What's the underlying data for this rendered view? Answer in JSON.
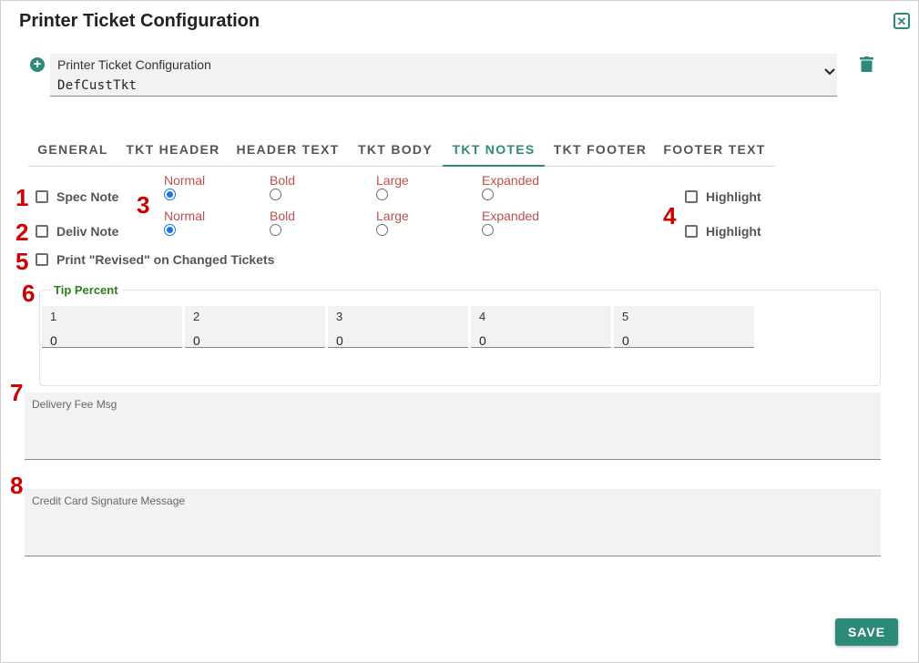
{
  "dialog": {
    "title": "Printer Ticket Configuration"
  },
  "icons": {
    "close": "close-icon",
    "add": "add-icon",
    "delete": "trash-icon",
    "dropdown": "chevron-down-icon"
  },
  "colors": {
    "accent": "#2e8a78",
    "annotation": "#cc0000",
    "radio_label": "#c0504d",
    "radio_selected": "#1a73e8",
    "tip_legend": "#2e7d1e"
  },
  "config_select": {
    "label": "Printer Ticket Configuration",
    "value": "DefCustTkt"
  },
  "tabs": [
    {
      "label": "GENERAL",
      "active": false
    },
    {
      "label": "TKT HEADER",
      "active": false
    },
    {
      "label": "HEADER TEXT",
      "active": false
    },
    {
      "label": "TKT BODY",
      "active": false
    },
    {
      "label": "TKT NOTES",
      "active": true
    },
    {
      "label": "TKT FOOTER",
      "active": false
    },
    {
      "label": "FOOTER TEXT",
      "active": false
    }
  ],
  "annotations": [
    "1",
    "2",
    "3",
    "4",
    "5",
    "6",
    "7",
    "8"
  ],
  "notes": {
    "spec_note": {
      "label": "Spec Note",
      "checked": false
    },
    "deliv_note": {
      "label": "Deliv Note",
      "checked": false
    },
    "print_revised": {
      "label": "Print \"Revised\" on Changed Tickets",
      "checked": false
    },
    "style_rows": [
      {
        "options": [
          "Normal",
          "Bold",
          "Large",
          "Expanded"
        ],
        "selected": "Normal",
        "highlight": {
          "label": "Highlight",
          "checked": false
        }
      },
      {
        "options": [
          "Normal",
          "Bold",
          "Large",
          "Expanded"
        ],
        "selected": "Normal",
        "highlight": {
          "label": "Highlight",
          "checked": false
        }
      }
    ]
  },
  "tip_percent": {
    "legend": "Tip Percent",
    "fields": [
      {
        "label": "1",
        "value": "0"
      },
      {
        "label": "2",
        "value": "0"
      },
      {
        "label": "3",
        "value": "0"
      },
      {
        "label": "4",
        "value": "0"
      },
      {
        "label": "5",
        "value": "0"
      }
    ]
  },
  "delivery_fee_msg": {
    "label": "Delivery Fee Msg",
    "value": ""
  },
  "cc_signature_msg": {
    "label": "Credit Card Signature Message",
    "value": ""
  },
  "save_label": "SAVE"
}
